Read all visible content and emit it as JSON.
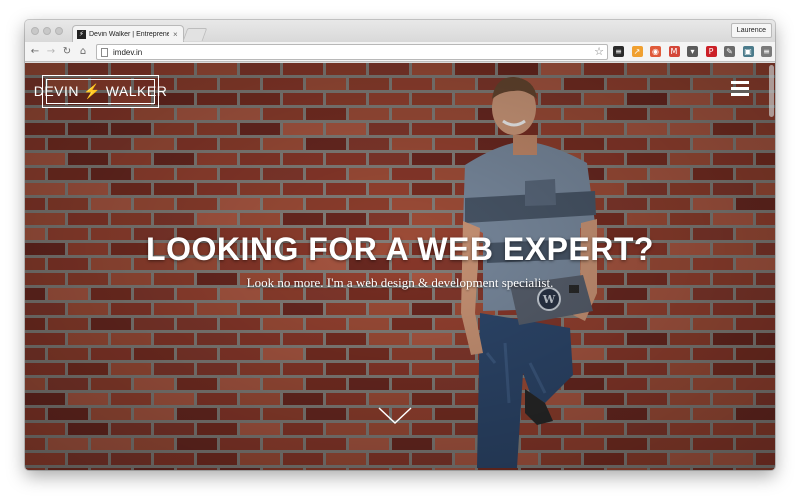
{
  "browser": {
    "tab": {
      "favicon": "devin-walker-favicon",
      "title": "Devin Walker | Entrepreneur",
      "close": "×"
    },
    "profile": "Laurence",
    "url": "imdev.in",
    "nav": {
      "back": "←",
      "forward": "→",
      "reload": "↻",
      "home": "⌂"
    },
    "star": "☆",
    "extensions": [
      {
        "name": "buffer-icon",
        "color": "#2b2b2b",
        "glyph": "≡"
      },
      {
        "name": "analytics-icon",
        "color": "#f0a030",
        "glyph": "↗"
      },
      {
        "name": "ghostery-icon",
        "color": "#e05a3a",
        "glyph": "◉"
      },
      {
        "name": "gmail-icon",
        "color": "#d44638",
        "glyph": "M"
      },
      {
        "name": "pocket-icon",
        "color": "#5b5b5b",
        "glyph": "▾"
      },
      {
        "name": "pinterest-icon",
        "color": "#cb2027",
        "glyph": "P"
      },
      {
        "name": "evernote-icon",
        "color": "#6a6a6a",
        "glyph": "✎"
      },
      {
        "name": "window-icon",
        "color": "#4a7a8a",
        "glyph": "▣"
      },
      {
        "name": "menu-icon",
        "color": "#7a7a7a",
        "glyph": "≡"
      }
    ]
  },
  "site": {
    "logo": "DEVIN ⚡ WALKER",
    "headline": "LOOKING FOR A WEB EXPERT?",
    "subline": "Look no more. I'm a web design & development specialist."
  }
}
